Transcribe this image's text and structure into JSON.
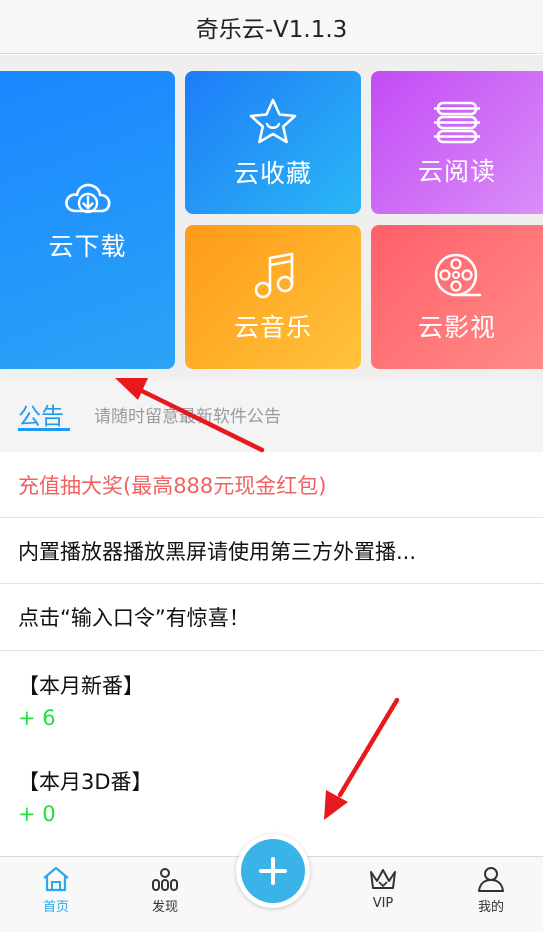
{
  "app": {
    "title": "奇乐云-V1.1.3"
  },
  "tiles": {
    "download": "云下载",
    "collect": "云收藏",
    "read": "云阅读",
    "music": "云音乐",
    "movie": "云影视"
  },
  "notice": {
    "tab_label": "公告",
    "hint": "请随时留意最新软件公告"
  },
  "announcements": [
    "充值抽大奖(最高888元现金红包)",
    "内置播放器播放黑屏请使用第三方外置播...",
    "点击“输入口令”有惊喜！"
  ],
  "monthly": [
    {
      "title": "【本月新番】",
      "count": "+ 6"
    },
    {
      "title": "【本月3D番】",
      "count": "+ 0"
    }
  ],
  "nav": {
    "home": "首页",
    "discover": "发现",
    "vip": "VIP",
    "mine": "我的"
  },
  "colors": {
    "accent": "#1d9bf0",
    "highlight_red": "#f06262",
    "count_green": "#21e03a",
    "fab_blue": "#3ab4e8",
    "annotation_arrow": "#e8191c"
  },
  "icons": {
    "download": "cloud-download-icon",
    "collect": "star-icon",
    "read": "book-stack-icon",
    "music": "music-note-icon",
    "movie": "film-reel-icon",
    "home": "home-icon",
    "discover": "discover-icon",
    "vip": "crown-icon",
    "mine": "user-icon",
    "fab": "plus-icon"
  }
}
